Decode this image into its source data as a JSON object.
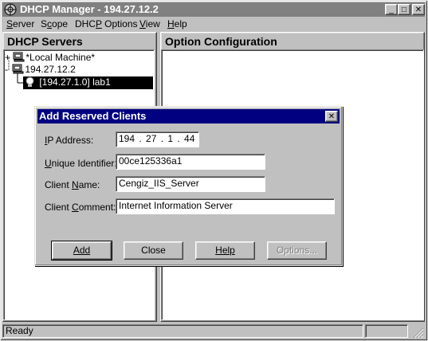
{
  "window": {
    "title": "DHCP Manager - 194.27.12.2",
    "minimize": "_",
    "maximize": "□",
    "close": "✕"
  },
  "menu": [
    {
      "label": "Server"
    },
    {
      "label": "Scope"
    },
    {
      "label": "DHCP Options"
    },
    {
      "label": "View"
    },
    {
      "label": "Help"
    }
  ],
  "left_pane": {
    "header": "DHCP Servers",
    "tree": [
      {
        "expander": "+",
        "label": "*Local Machine*",
        "icon": "server-icon"
      },
      {
        "expander": "-",
        "label": "194.27.12.2",
        "icon": "server-icon"
      },
      {
        "expander": "",
        "label": "[194.27.1.0] lab1",
        "icon": "scope-bulb-icon",
        "selected": true
      }
    ]
  },
  "right_pane": {
    "header": "Option Configuration"
  },
  "status": {
    "text": "Ready"
  },
  "dialog": {
    "title": "Add Reserved Clients",
    "close": "✕",
    "ip_label": "IP Address:",
    "ip_value": "194 . 27 . 1 . 44",
    "uid_label": "Unique Identifier:",
    "uid_value": "00ce125336a1",
    "name_label": "Client Name:",
    "name_value": "Cengiz_IIS_Server",
    "comment_label": "Client Comment:",
    "comment_value": "Internet Information Server",
    "buttons": {
      "add": "Add",
      "close": "Close",
      "help": "Help",
      "options": "Options..."
    }
  },
  "colors": {
    "inactive_title": "#808080",
    "active_title": "#000080",
    "selection": "#000000",
    "face": "#c0c0c0"
  }
}
